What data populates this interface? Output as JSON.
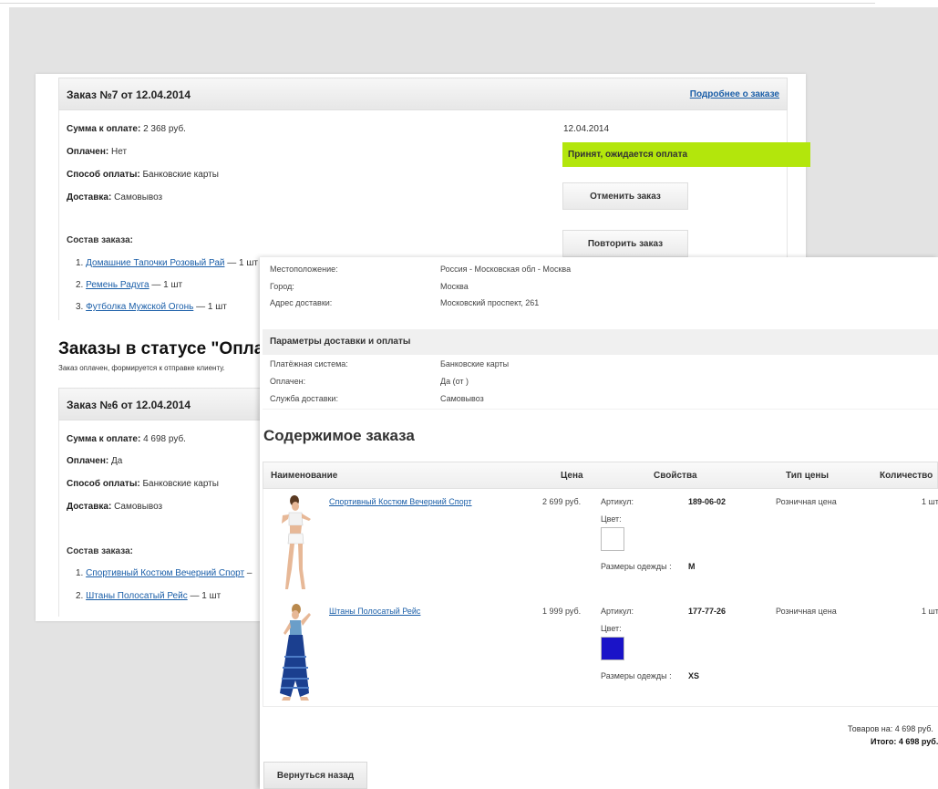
{
  "order7": {
    "title": "Заказ №7 от 12.04.2014",
    "details_link": "Подробнее о заказе",
    "sum_label": "Сумма к оплате:",
    "sum_value": "2 368 руб.",
    "paid_label": "Оплачен:",
    "paid_value": "Нет",
    "pay_method_label": "Способ оплаты:",
    "pay_method_value": "Банковские карты",
    "delivery_label": "Доставка:",
    "delivery_value": "Самовывоз",
    "date": "12.04.2014",
    "status": "Принят, ожидается оплата",
    "cancel_button": "Отменить заказ",
    "repeat_button": "Повторить заказ",
    "contents_label": "Состав заказа:",
    "items": [
      {
        "num": "1.",
        "name": "Домашние Тапочки Розовый Рай",
        "qty": "— 1 шт"
      },
      {
        "num": "2.",
        "name": "Ремень Радуга",
        "qty": "— 1 шт"
      },
      {
        "num": "3.",
        "name": "Футболка Мужской Огонь",
        "qty": "— 1 шт"
      }
    ]
  },
  "status_section": {
    "title": "Заказы в статусе \"Опла",
    "description": "Заказ оплачен, формируется к отправке клиенту."
  },
  "order6": {
    "title": "Заказ №6 от 12.04.2014",
    "sum_label": "Сумма к оплате:",
    "sum_value": "4 698 руб.",
    "paid_label": "Оплачен:",
    "paid_value": "Да",
    "pay_method_label": "Способ оплаты:",
    "pay_method_value": "Банковские карты",
    "delivery_label": "Доставка:",
    "delivery_value": "Самовывоз",
    "contents_label": "Состав заказа:",
    "items": [
      {
        "num": "1.",
        "name": "Спортивный Костюм Вечерний Спорт",
        "qty": "–"
      },
      {
        "num": "2.",
        "name": "Штаны Полосатый Рейс",
        "qty": "— 1 шт"
      }
    ]
  },
  "detail": {
    "location_label": "Местоположение:",
    "location_value": "Россия - Московская обл - Москва",
    "city_label": "Город:",
    "city_value": "Москва",
    "address_label": "Адрес доставки:",
    "address_value": "Московский проспект, 261",
    "params_title": "Параметры доставки и оплаты",
    "pay_system_label": "Платёжная система:",
    "pay_system_value": "Банковские карты",
    "paid_label": "Оплачен:",
    "paid_value": "Да (от )",
    "delivery_service_label": "Служба доставки:",
    "delivery_service_value": "Самовывоз",
    "content_title": "Содержимое заказа",
    "columns": [
      "Наименование",
      "Цена",
      "Свойства",
      "Тип цены",
      "Количество"
    ],
    "products": [
      {
        "name": "Спортивный Костюм Вечерний Спорт",
        "price": "2 699 руб.",
        "article_label": "Артикул:",
        "article": "189-06-02",
        "color_label": "Цвет:",
        "color": "#ffffff",
        "size_label": "Размеры одежды :",
        "size": "M",
        "price_type": "Розничная цена",
        "qty": "1 шт"
      },
      {
        "name": "Штаны Полосатый Рейс",
        "price": "1 999 руб.",
        "article_label": "Артикул:",
        "article": "177-77-26",
        "color_label": "Цвет:",
        "color": "#1a13c8",
        "size_label": "Размеры одежды :",
        "size": "XS",
        "price_type": "Розничная цена",
        "qty": "1 шт"
      }
    ],
    "goods_total": "Товаров на: 4 698 руб.",
    "grand_total": "Итого: 4 698 руб.",
    "back_button": "Вернуться назад"
  }
}
